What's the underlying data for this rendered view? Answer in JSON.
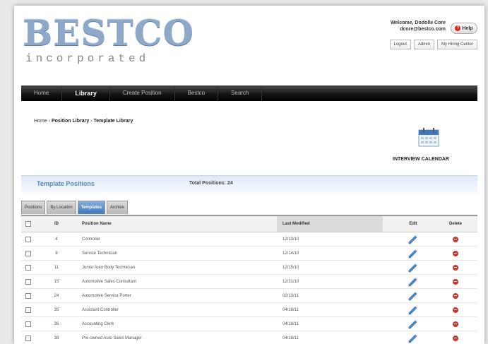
{
  "logo": {
    "main": "BESTCO",
    "sub": "incorporated"
  },
  "user": {
    "welcome": "Welcome, Dodolle Core",
    "email": "dcore@bestco.com",
    "help_label": "Help",
    "help_icon": "help-icon"
  },
  "user_links": [
    "Logout",
    "Admin",
    "My Hiring Center"
  ],
  "nav": {
    "items": [
      "Home",
      "Library",
      "Create Position",
      "Bestco",
      "Search"
    ],
    "active": "Library"
  },
  "breadcrumb": {
    "items": [
      "Home",
      "Position Library",
      "Template Library"
    ],
    "separator": "›"
  },
  "calendar": {
    "label": "INTERVIEW CALENDAR",
    "icon": "calendar-icon"
  },
  "section": {
    "title": "Template Positions",
    "total": "Total Positions: 24"
  },
  "tabs": [
    {
      "label": "Positions",
      "active": false
    },
    {
      "label": "By Location",
      "active": false
    },
    {
      "label": "Templates",
      "active": true
    },
    {
      "label": "Archive",
      "active": false
    }
  ],
  "table": {
    "headers": {
      "id": "ID",
      "name": "Position Name",
      "modified": "Last Modified",
      "edit": "Edit",
      "delete": "Delete"
    },
    "rows": [
      {
        "id": "4",
        "name": "Controller",
        "modified": "12/13/10"
      },
      {
        "id": "8",
        "name": "Service Technician",
        "modified": "12/14/10"
      },
      {
        "id": "11",
        "name": "Junior Auto Body Technician",
        "modified": "12/15/10"
      },
      {
        "id": "15",
        "name": "Automotive Sales Consultant",
        "modified": "12/31/10"
      },
      {
        "id": "24",
        "name": "Automotive Service Porter",
        "modified": "02/13/11"
      },
      {
        "id": "35",
        "name": "Assistant Controller",
        "modified": "04/18/11"
      },
      {
        "id": "36",
        "name": "Accounting Clerk",
        "modified": "04/18/11"
      },
      {
        "id": "38",
        "name": "Pre-owned Auto Sales Manager",
        "modified": "04/18/11"
      }
    ]
  },
  "colors": {
    "accent": "#5c86b6",
    "delete": "#d6312a",
    "nav_bg": "#111111",
    "tab_active": "#3f76bd"
  }
}
